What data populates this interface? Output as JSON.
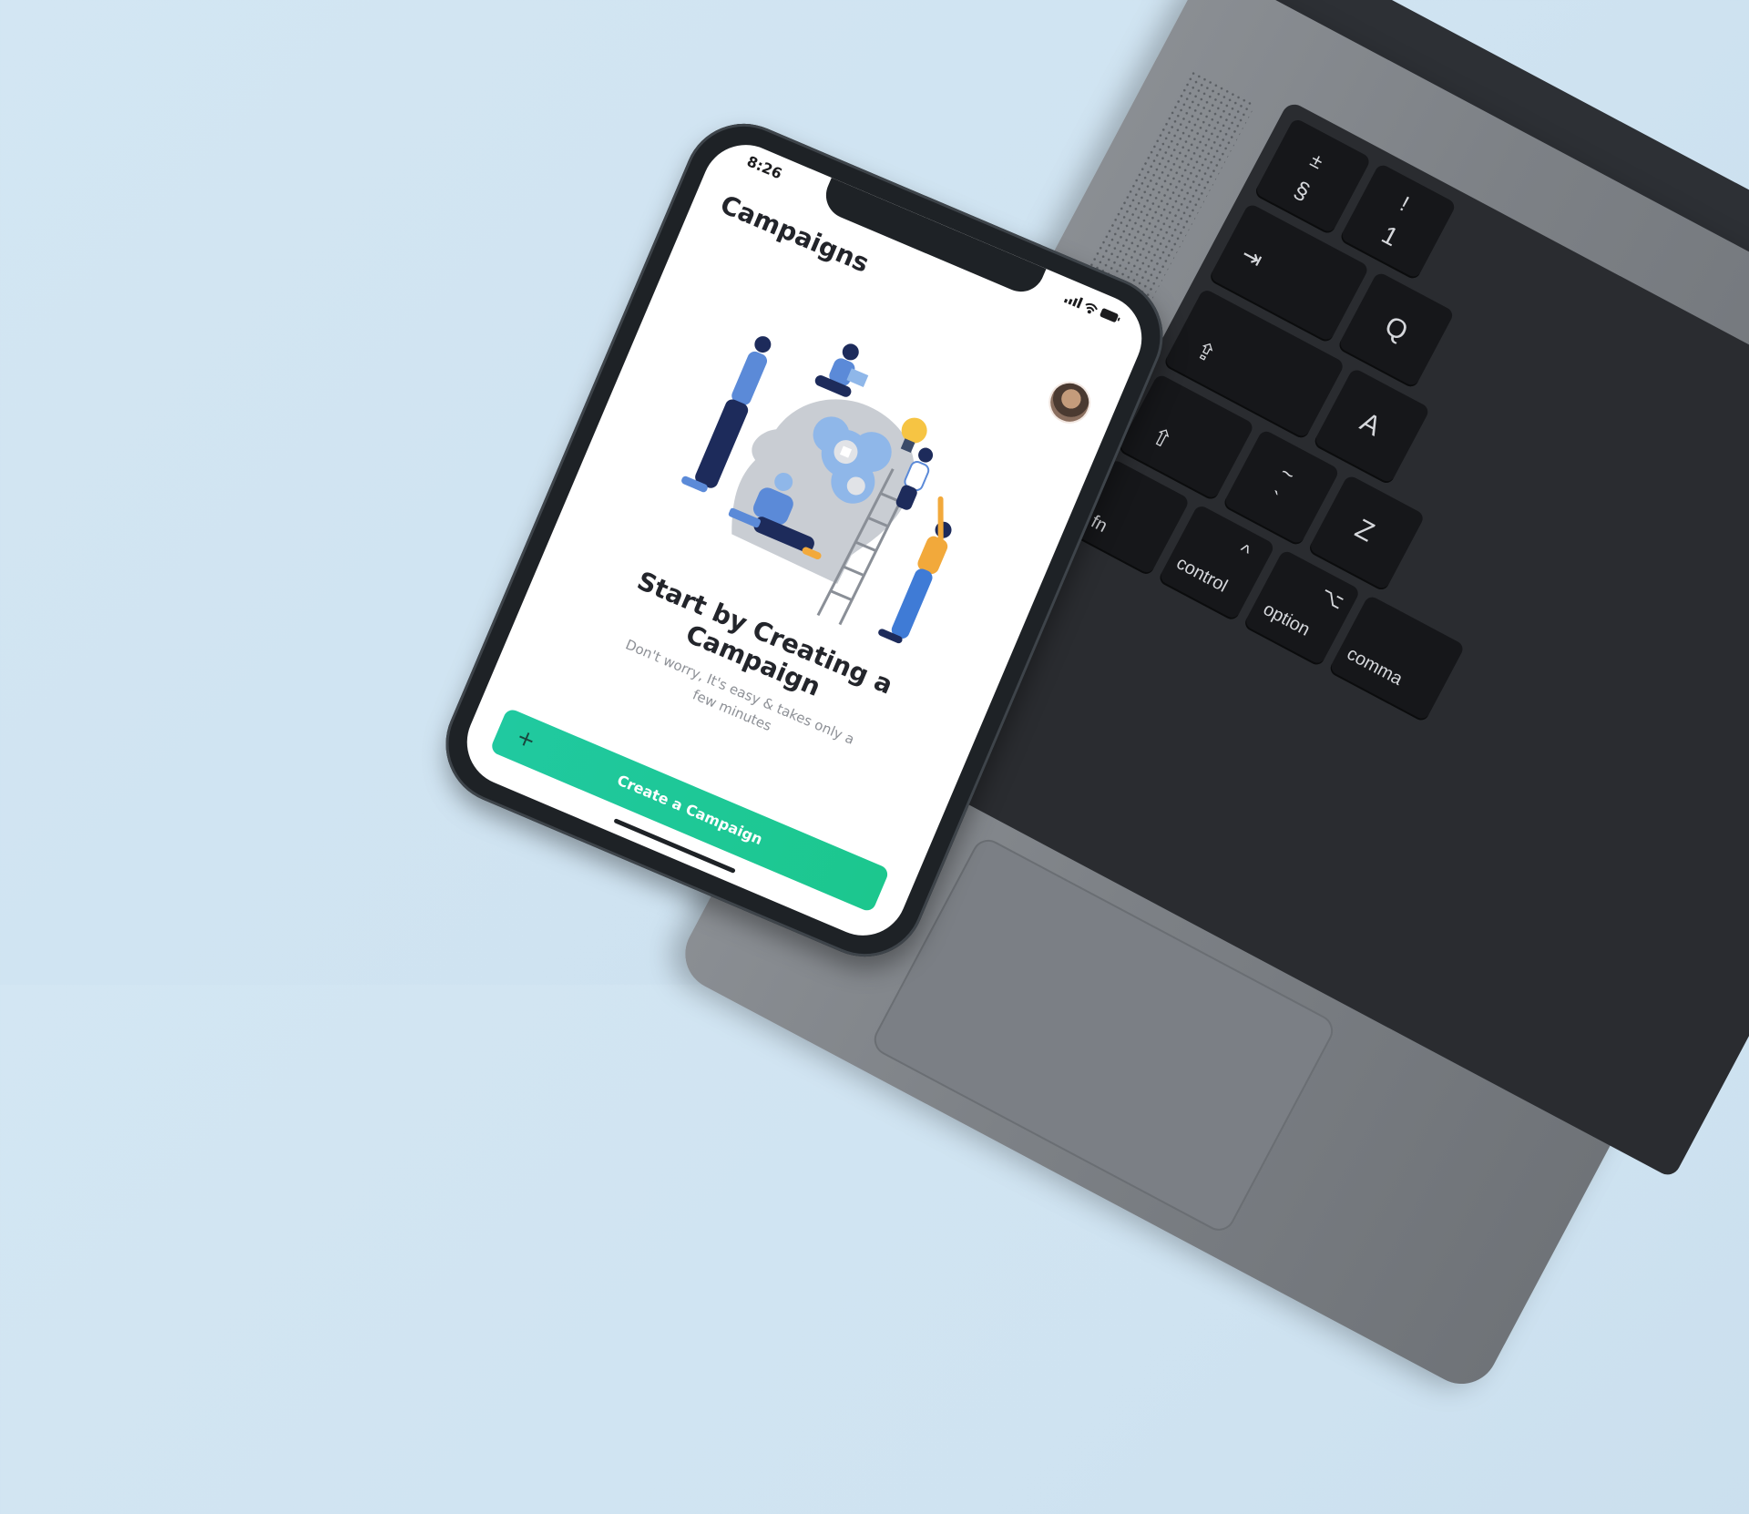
{
  "status_bar": {
    "time": "8:26"
  },
  "screen": {
    "title": "Campaigns",
    "headline": "Start by Creating a Campaign",
    "subline": "Don't worry, It's easy & takes only a few minutes",
    "cta": {
      "icon": "plus-icon",
      "label": "Create a Campaign",
      "color": "#1ec99a"
    }
  },
  "keyboard": {
    "keys": {
      "plusminus_top": "±",
      "section": "§",
      "exclaim": "!",
      "one": "1",
      "tab": "⇥",
      "q": "Q",
      "capslock": "⇪",
      "a": "A",
      "shift": "⇧",
      "tilde": "~",
      "backtick": "`",
      "z": "Z",
      "fn": "fn",
      "control_caret": "^",
      "control": "control",
      "option_symbol": "⌥",
      "option": "option",
      "command": "comma"
    }
  }
}
